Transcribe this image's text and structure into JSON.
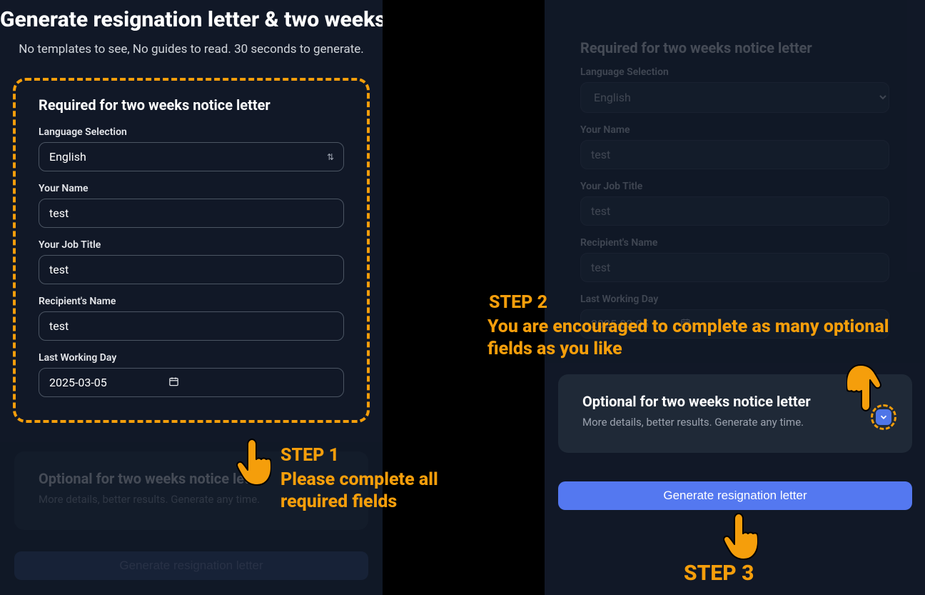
{
  "header": {
    "title": "Generate resignation letter & two weeks notice letter",
    "subtitle": "No templates to see, No guides to read. 30 seconds to generate."
  },
  "required": {
    "title": "Required for two weeks notice letter",
    "language_label": "Language Selection",
    "language_value": "English",
    "name_label": "Your Name",
    "name_value": "test",
    "job_label": "Your Job Title",
    "job_value": "test",
    "recipient_label": "Recipient's Name",
    "recipient_value": "test",
    "lastday_label": "Last Working Day",
    "lastday_value": "2025-03-05"
  },
  "optional": {
    "title": "Optional for two weeks notice letter",
    "subtitle": "More details, better results. Generate any time."
  },
  "buttons": {
    "generate": "Generate resignation letter"
  },
  "annotations": {
    "step1_head": "STEP 1",
    "step1_body": "Please complete all required fields",
    "step2_head": "STEP 2",
    "step2_body": "You are encouraged to complete as many optional fields as you like",
    "step3_head": "STEP 3"
  },
  "colors": {
    "accent": "#f59e0b",
    "primary_button": "#5478f0",
    "bg_panel": "#111827",
    "bg_card": "#1f2937"
  }
}
